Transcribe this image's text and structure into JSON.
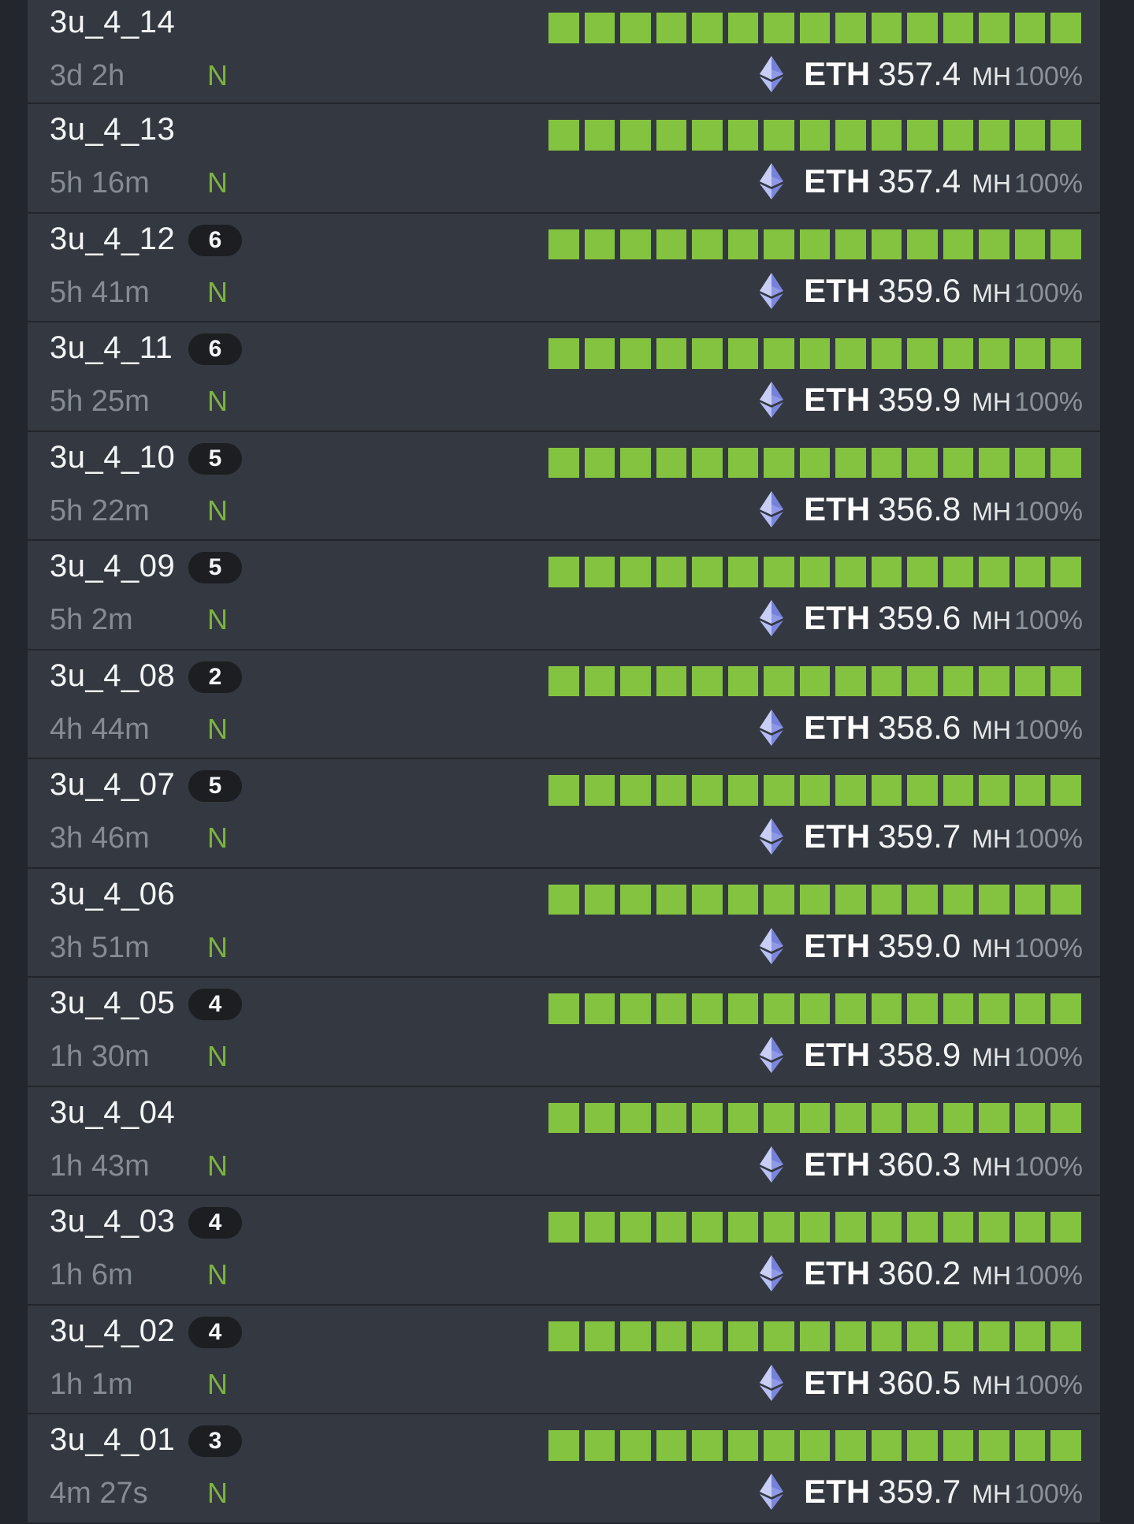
{
  "accent_color": "#84c340",
  "coin_icon": "ethereum-icon",
  "workers": [
    {
      "name": "3u_4_14",
      "badge": "",
      "uptime": "3d 2h",
      "flag": "N",
      "coin": "ETH",
      "hashrate": "357.4",
      "unit": "MH",
      "percent": "100%",
      "gpu_count": 15
    },
    {
      "name": "3u_4_13",
      "badge": "",
      "uptime": "5h 16m",
      "flag": "N",
      "coin": "ETH",
      "hashrate": "357.4",
      "unit": "MH",
      "percent": "100%",
      "gpu_count": 15
    },
    {
      "name": "3u_4_12",
      "badge": "6",
      "uptime": "5h 41m",
      "flag": "N",
      "coin": "ETH",
      "hashrate": "359.6",
      "unit": "MH",
      "percent": "100%",
      "gpu_count": 15
    },
    {
      "name": "3u_4_11",
      "badge": "6",
      "uptime": "5h 25m",
      "flag": "N",
      "coin": "ETH",
      "hashrate": "359.9",
      "unit": "MH",
      "percent": "100%",
      "gpu_count": 15
    },
    {
      "name": "3u_4_10",
      "badge": "5",
      "uptime": "5h 22m",
      "flag": "N",
      "coin": "ETH",
      "hashrate": "356.8",
      "unit": "MH",
      "percent": "100%",
      "gpu_count": 15
    },
    {
      "name": "3u_4_09",
      "badge": "5",
      "uptime": "5h 2m",
      "flag": "N",
      "coin": "ETH",
      "hashrate": "359.6",
      "unit": "MH",
      "percent": "100%",
      "gpu_count": 15
    },
    {
      "name": "3u_4_08",
      "badge": "2",
      "uptime": "4h 44m",
      "flag": "N",
      "coin": "ETH",
      "hashrate": "358.6",
      "unit": "MH",
      "percent": "100%",
      "gpu_count": 15
    },
    {
      "name": "3u_4_07",
      "badge": "5",
      "uptime": "3h 46m",
      "flag": "N",
      "coin": "ETH",
      "hashrate": "359.7",
      "unit": "MH",
      "percent": "100%",
      "gpu_count": 15
    },
    {
      "name": "3u_4_06",
      "badge": "",
      "uptime": "3h 51m",
      "flag": "N",
      "coin": "ETH",
      "hashrate": "359.0",
      "unit": "MH",
      "percent": "100%",
      "gpu_count": 15
    },
    {
      "name": "3u_4_05",
      "badge": "4",
      "uptime": "1h 30m",
      "flag": "N",
      "coin": "ETH",
      "hashrate": "358.9",
      "unit": "MH",
      "percent": "100%",
      "gpu_count": 15
    },
    {
      "name": "3u_4_04",
      "badge": "",
      "uptime": "1h 43m",
      "flag": "N",
      "coin": "ETH",
      "hashrate": "360.3",
      "unit": "MH",
      "percent": "100%",
      "gpu_count": 15
    },
    {
      "name": "3u_4_03",
      "badge": "4",
      "uptime": "1h 6m",
      "flag": "N",
      "coin": "ETH",
      "hashrate": "360.2",
      "unit": "MH",
      "percent": "100%",
      "gpu_count": 15
    },
    {
      "name": "3u_4_02",
      "badge": "4",
      "uptime": "1h 1m",
      "flag": "N",
      "coin": "ETH",
      "hashrate": "360.5",
      "unit": "MH",
      "percent": "100%",
      "gpu_count": 15
    },
    {
      "name": "3u_4_01",
      "badge": "3",
      "uptime": "4m 27s",
      "flag": "N",
      "coin": "ETH",
      "hashrate": "359.7",
      "unit": "MH",
      "percent": "100%",
      "gpu_count": 15
    }
  ]
}
